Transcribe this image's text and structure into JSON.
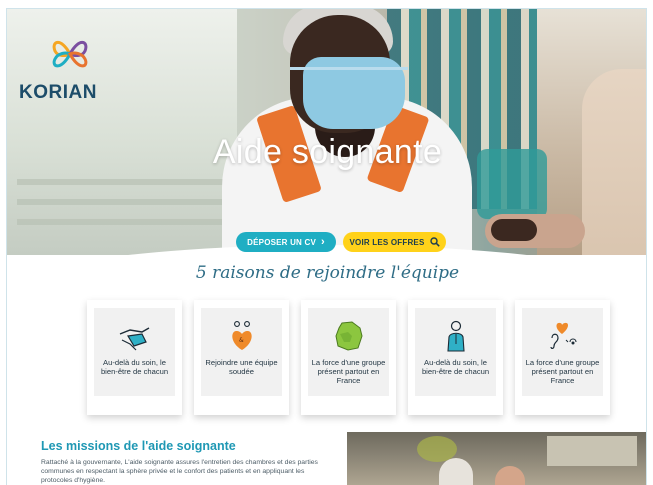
{
  "brand": {
    "name": "KORIAN"
  },
  "hero": {
    "title": "Aide soignante"
  },
  "cta": {
    "cv_label": "DÉPOSER UN CV",
    "cv_icon": "chevron-right-icon",
    "offres_label": "VOIR LES OFFRES",
    "offres_icon": "search-icon"
  },
  "reasons": {
    "title": "5 raisons de rejoindre l'équipe",
    "cards": [
      {
        "label": "Au-delà du soin, le bien-être de chacun",
        "icon": "care-hands-icon"
      },
      {
        "label": "Rejoindre une équipe soudée",
        "icon": "team-heart-icon"
      },
      {
        "label": "La force d'une groupe présent partout en France",
        "icon": "france-map-icon"
      },
      {
        "label": "Au-delà du soin, le bien-être de chacun",
        "icon": "caregiver-person-icon"
      },
      {
        "label": "La force d'une groupe présent partout en France",
        "icon": "listening-heart-icon"
      }
    ]
  },
  "missions": {
    "title": "Les missions de l'aide soignante",
    "text": "Rattaché à la gouvernante, L'aide soignante assures l'entretien des chambres et des parties communes en respectant la sphère privée et le confort des patients et en appliquant les protocoles d'hygiène."
  },
  "colors": {
    "brand_blue": "#1c4c69",
    "accent_teal": "#1faec3",
    "accent_yellow": "#ffd21a",
    "heading_teal": "#1f98b4"
  }
}
